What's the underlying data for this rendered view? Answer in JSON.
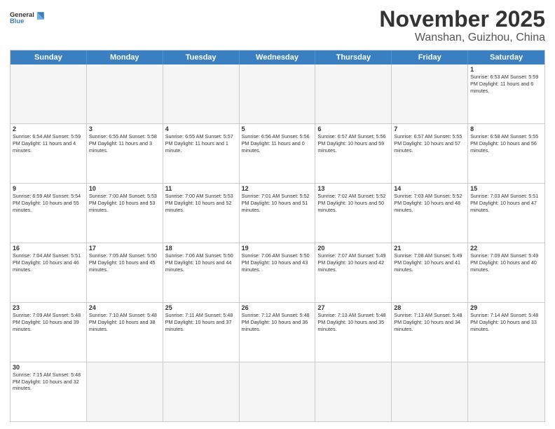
{
  "header": {
    "logo_general": "General",
    "logo_blue": "Blue",
    "title": "November 2025",
    "subtitle": "Wanshan, Guizhou, China"
  },
  "days": [
    "Sunday",
    "Monday",
    "Tuesday",
    "Wednesday",
    "Thursday",
    "Friday",
    "Saturday"
  ],
  "weeks": [
    [
      {
        "day": "",
        "info": "",
        "empty": true
      },
      {
        "day": "",
        "info": "",
        "empty": true
      },
      {
        "day": "",
        "info": "",
        "empty": true
      },
      {
        "day": "",
        "info": "",
        "empty": true
      },
      {
        "day": "",
        "info": "",
        "empty": true
      },
      {
        "day": "",
        "info": "",
        "empty": true
      },
      {
        "day": "1",
        "info": "Sunrise: 6:53 AM\nSunset: 5:59 PM\nDaylight: 11 hours and 6 minutes.",
        "empty": false
      }
    ],
    [
      {
        "day": "2",
        "info": "Sunrise: 6:54 AM\nSunset: 5:59 PM\nDaylight: 11 hours and 4 minutes.",
        "empty": false
      },
      {
        "day": "3",
        "info": "Sunrise: 6:55 AM\nSunset: 5:58 PM\nDaylight: 11 hours and 3 minutes.",
        "empty": false
      },
      {
        "day": "4",
        "info": "Sunrise: 6:55 AM\nSunset: 5:57 PM\nDaylight: 11 hours and 1 minute.",
        "empty": false
      },
      {
        "day": "5",
        "info": "Sunrise: 6:56 AM\nSunset: 5:56 PM\nDaylight: 11 hours and 0 minutes.",
        "empty": false
      },
      {
        "day": "6",
        "info": "Sunrise: 6:57 AM\nSunset: 5:56 PM\nDaylight: 10 hours and 59 minutes.",
        "empty": false
      },
      {
        "day": "7",
        "info": "Sunrise: 6:57 AM\nSunset: 5:55 PM\nDaylight: 10 hours and 57 minutes.",
        "empty": false
      },
      {
        "day": "8",
        "info": "Sunrise: 6:58 AM\nSunset: 5:55 PM\nDaylight: 10 hours and 56 minutes.",
        "empty": false
      }
    ],
    [
      {
        "day": "9",
        "info": "Sunrise: 6:59 AM\nSunset: 5:54 PM\nDaylight: 10 hours and 55 minutes.",
        "empty": false
      },
      {
        "day": "10",
        "info": "Sunrise: 7:00 AM\nSunset: 5:53 PM\nDaylight: 10 hours and 53 minutes.",
        "empty": false
      },
      {
        "day": "11",
        "info": "Sunrise: 7:00 AM\nSunset: 5:53 PM\nDaylight: 10 hours and 52 minutes.",
        "empty": false
      },
      {
        "day": "12",
        "info": "Sunrise: 7:01 AM\nSunset: 5:52 PM\nDaylight: 10 hours and 51 minutes.",
        "empty": false
      },
      {
        "day": "13",
        "info": "Sunrise: 7:02 AM\nSunset: 5:52 PM\nDaylight: 10 hours and 50 minutes.",
        "empty": false
      },
      {
        "day": "14",
        "info": "Sunrise: 7:03 AM\nSunset: 5:52 PM\nDaylight: 10 hours and 48 minutes.",
        "empty": false
      },
      {
        "day": "15",
        "info": "Sunrise: 7:03 AM\nSunset: 5:51 PM\nDaylight: 10 hours and 47 minutes.",
        "empty": false
      }
    ],
    [
      {
        "day": "16",
        "info": "Sunrise: 7:04 AM\nSunset: 5:51 PM\nDaylight: 10 hours and 46 minutes.",
        "empty": false
      },
      {
        "day": "17",
        "info": "Sunrise: 7:05 AM\nSunset: 5:50 PM\nDaylight: 10 hours and 45 minutes.",
        "empty": false
      },
      {
        "day": "18",
        "info": "Sunrise: 7:06 AM\nSunset: 5:50 PM\nDaylight: 10 hours and 44 minutes.",
        "empty": false
      },
      {
        "day": "19",
        "info": "Sunrise: 7:06 AM\nSunset: 5:50 PM\nDaylight: 10 hours and 43 minutes.",
        "empty": false
      },
      {
        "day": "20",
        "info": "Sunrise: 7:07 AM\nSunset: 5:49 PM\nDaylight: 10 hours and 42 minutes.",
        "empty": false
      },
      {
        "day": "21",
        "info": "Sunrise: 7:08 AM\nSunset: 5:49 PM\nDaylight: 10 hours and 41 minutes.",
        "empty": false
      },
      {
        "day": "22",
        "info": "Sunrise: 7:09 AM\nSunset: 5:49 PM\nDaylight: 10 hours and 40 minutes.",
        "empty": false
      }
    ],
    [
      {
        "day": "23",
        "info": "Sunrise: 7:09 AM\nSunset: 5:48 PM\nDaylight: 10 hours and 39 minutes.",
        "empty": false
      },
      {
        "day": "24",
        "info": "Sunrise: 7:10 AM\nSunset: 5:48 PM\nDaylight: 10 hours and 38 minutes.",
        "empty": false
      },
      {
        "day": "25",
        "info": "Sunrise: 7:11 AM\nSunset: 5:48 PM\nDaylight: 10 hours and 37 minutes.",
        "empty": false
      },
      {
        "day": "26",
        "info": "Sunrise: 7:12 AM\nSunset: 5:48 PM\nDaylight: 10 hours and 36 minutes.",
        "empty": false
      },
      {
        "day": "27",
        "info": "Sunrise: 7:13 AM\nSunset: 5:48 PM\nDaylight: 10 hours and 35 minutes.",
        "empty": false
      },
      {
        "day": "28",
        "info": "Sunrise: 7:13 AM\nSunset: 5:48 PM\nDaylight: 10 hours and 34 minutes.",
        "empty": false
      },
      {
        "day": "29",
        "info": "Sunrise: 7:14 AM\nSunset: 5:48 PM\nDaylight: 10 hours and 33 minutes.",
        "empty": false
      }
    ],
    [
      {
        "day": "30",
        "info": "Sunrise: 7:15 AM\nSunset: 5:48 PM\nDaylight: 10 hours and 32 minutes.",
        "empty": false
      },
      {
        "day": "",
        "info": "",
        "empty": true
      },
      {
        "day": "",
        "info": "",
        "empty": true
      },
      {
        "day": "",
        "info": "",
        "empty": true
      },
      {
        "day": "",
        "info": "",
        "empty": true
      },
      {
        "day": "",
        "info": "",
        "empty": true
      },
      {
        "day": "",
        "info": "",
        "empty": true
      }
    ]
  ]
}
